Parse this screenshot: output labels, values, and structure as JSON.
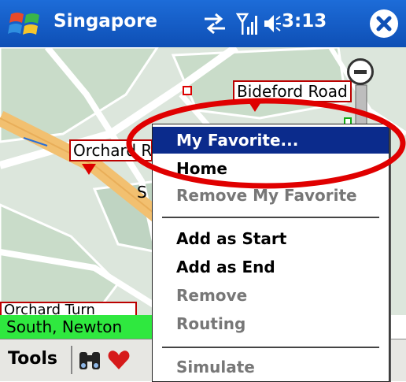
{
  "titlebar": {
    "title": "Singapore",
    "clock": "3:13"
  },
  "map": {
    "labels": [
      "Bideford Road",
      "Orchard R",
      "Orchard Turn"
    ],
    "area_fragment": "S",
    "status_text": "South, Newton"
  },
  "toolbar": {
    "tools_label": "Tools"
  },
  "context_menu": {
    "items": [
      {
        "label": "My Favorite...",
        "state": "selected"
      },
      {
        "label": "Home",
        "state": "enabled"
      },
      {
        "label": "Remove My Favorite",
        "state": "disabled"
      },
      {
        "label": "Add as Start",
        "state": "enabled"
      },
      {
        "label": "Add as End",
        "state": "enabled"
      },
      {
        "label": "Remove",
        "state": "disabled"
      },
      {
        "label": "Routing",
        "state": "disabled"
      },
      {
        "label": "Simulate",
        "state": "disabled"
      }
    ]
  },
  "colors": {
    "titlebar": "#0e4fb5",
    "menu_selected": "#0b2b8c",
    "status_strip": "#2fe83f",
    "annotation": "#e00000",
    "road": "#f2c070"
  },
  "icons": [
    "windows-logo-icon",
    "sync-icon",
    "signal-icon",
    "speaker-icon",
    "close-icon",
    "zoom-out-icon",
    "map-pin-icon",
    "binoculars-icon",
    "heart-icon"
  ]
}
